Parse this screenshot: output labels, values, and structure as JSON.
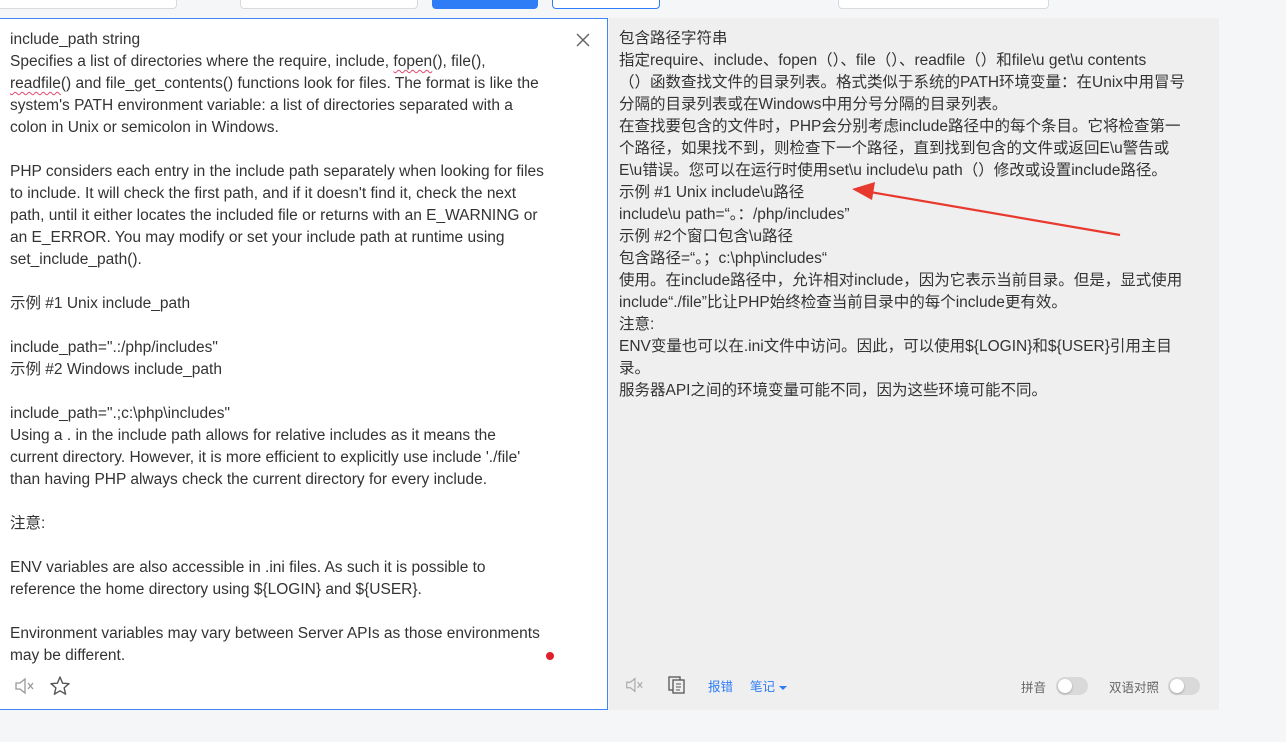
{
  "source": {
    "lines": [
      {
        "t": "include_path string"
      },
      {
        "t": "Specifies a list of directories where the require, include, ",
        "u1": "fopen",
        "t2": "(), file(),"
      },
      {
        "u1": "readfile",
        "t2": "() and file_get_contents() functions look for files. The format is like the"
      },
      {
        "t": "system's PATH environment variable: a list of directories separated with a"
      },
      {
        "t": "colon in Unix or semicolon in Windows."
      },
      {
        "t": ""
      },
      {
        "t": "PHP considers each entry in the include path separately when looking for files"
      },
      {
        "t": "to include. It will check the first path, and if it doesn't find it, check the next"
      },
      {
        "t": "path, until it either locates the included file or returns with an E_WARNING or"
      },
      {
        "t": "an E_ERROR. You may modify or set your include path at runtime using"
      },
      {
        "t": "set_include_path()."
      },
      {
        "t": ""
      },
      {
        "t": "示例 #1 Unix include_path"
      },
      {
        "t": ""
      },
      {
        "t": "include_path=\".:/php/includes\""
      },
      {
        "t": "示例 #2 Windows include_path"
      },
      {
        "t": ""
      },
      {
        "t": "include_path=\".;c:\\php\\includes\""
      },
      {
        "t": "Using a . in the include path allows for relative includes as it means the"
      },
      {
        "t": "current directory. However, it is more efficient to explicitly use include './file'"
      },
      {
        "t": "than having PHP always check the current directory for every include."
      },
      {
        "t": ""
      },
      {
        "t": "注意:"
      },
      {
        "t": ""
      },
      {
        "t": "ENV variables are also accessible in .ini files. As such it is possible to"
      },
      {
        "t": "reference the home directory using ${LOGIN} and ${USER}."
      },
      {
        "t": ""
      },
      {
        "t": "Environment variables may vary between Server APIs as those environments"
      },
      {
        "t": "may be different."
      }
    ]
  },
  "target": {
    "lines": [
      "包含路径字符串",
      "指定require、include、fopen（）、file（）、readfile（）和file\\u get\\u contents",
      "（）函数查找文件的目录列表。格式类似于系统的PATH环境变量：在Unix中用冒号",
      "分隔的目录列表或在Windows中用分号分隔的目录列表。",
      "在查找要包含的文件时，PHP会分别考虑include路径中的每个条目。它将检查第一",
      "个路径，如果找不到，则检查下一个路径，直到找到包含的文件或返回E\\u警告或",
      "E\\u错误。您可以在运行时使用set\\u include\\u path（）修改或设置include路径。",
      "示例 #1 Unix include\\u路径",
      "include\\u path=“。：/php/includes”",
      "示例 #2个窗口包含\\u路径",
      "包含路径=“。；c:\\php\\includes“",
      "使用。在include路径中，允许相对include，因为它表示当前目录。但是，显式使用",
      "include“./file”比让PHP始终检查当前目录中的每个include更有效。",
      "注意:",
      "ENV变量也可以在.ini文件中访问。因此，可以使用${LOGIN}和${USER}引用主目",
      "录。",
      "服务器API之间的环境变量可能不同，因为这些环境可能不同。"
    ]
  },
  "footer": {
    "report_error": "报错",
    "notes": "笔记",
    "pinyin": "拼音",
    "bilingual": "双语对照"
  },
  "icons": {
    "close": "close-icon",
    "speaker_source": "speaker-muted-icon",
    "star": "star-icon",
    "speaker_target": "speaker-muted-icon",
    "copy": "copy-icon",
    "dropdown": "caret-down-icon"
  },
  "colors": {
    "accent": "#2e7cf6",
    "annotation_arrow": "#e8392f",
    "spell_underline": "#e24a6e",
    "record_dot": "#e01f2e"
  }
}
